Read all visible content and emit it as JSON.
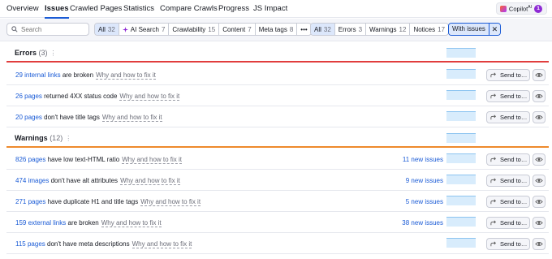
{
  "nav": {
    "tabs": [
      {
        "label": "Overview"
      },
      {
        "label": "Issues"
      },
      {
        "label": "Crawled Pages"
      },
      {
        "label": "Statistics"
      },
      {
        "label": "Compare Crawls"
      },
      {
        "label": "Progress"
      },
      {
        "label": "JS Impact"
      }
    ],
    "active_tab": "Issues",
    "copilot": {
      "label": "Copilot",
      "sup": "AI",
      "count": "1"
    }
  },
  "filters": {
    "search_placeholder": "Search",
    "categories": [
      {
        "label": "All",
        "count": "32"
      },
      {
        "label": "AI Search",
        "count": "7"
      },
      {
        "label": "Crawlability",
        "count": "15"
      },
      {
        "label": "Content",
        "count": "7"
      },
      {
        "label": "Meta tags",
        "count": "8"
      },
      {
        "label": "•••",
        "count": ""
      }
    ],
    "severity": [
      {
        "label": "All",
        "count": "32"
      },
      {
        "label": "Errors",
        "count": "3"
      },
      {
        "label": "Warnings",
        "count": "12"
      },
      {
        "label": "Notices",
        "count": "17"
      }
    ],
    "with_issues": "With issues",
    "clear": "✕"
  },
  "errors": {
    "title": "Errors",
    "count": "(3)",
    "rows": [
      {
        "link": "29 internal links",
        "text": " are broken",
        "why": "Why and how to fix it",
        "new": ""
      },
      {
        "link": "26 pages",
        "text": " returned 4XX status code",
        "why": "Why and how to fix it",
        "new": ""
      },
      {
        "link": "20 pages",
        "text": " don't have title tags",
        "why": "Why and how to fix it",
        "new": ""
      }
    ]
  },
  "warnings": {
    "title": "Warnings",
    "count": "(12)",
    "rows": [
      {
        "link": "826 pages",
        "text": " have low text-HTML ratio",
        "why": "Why and how to fix it",
        "new": "11 new issues"
      },
      {
        "link": "474 images",
        "text": " don't have alt attributes",
        "why": "Why and how to fix it",
        "new": "9 new issues"
      },
      {
        "link": "271 pages",
        "text": " have duplicate H1 and title tags",
        "why": "Why and how to fix it",
        "new": "5 new issues"
      },
      {
        "link": "159 external links",
        "text": " are broken",
        "why": "Why and how to fix it",
        "new": "38 new issues"
      },
      {
        "link": "115 pages",
        "text": " don't have meta descriptions",
        "why": "Why and how to fix it",
        "new": ""
      }
    ]
  },
  "actions": {
    "send_to": "Send to…"
  },
  "colors": {
    "accent": "#1a5bd6",
    "error": "#e13d3d",
    "warning": "#ee8a2c",
    "spark": "#d8ecfc"
  }
}
